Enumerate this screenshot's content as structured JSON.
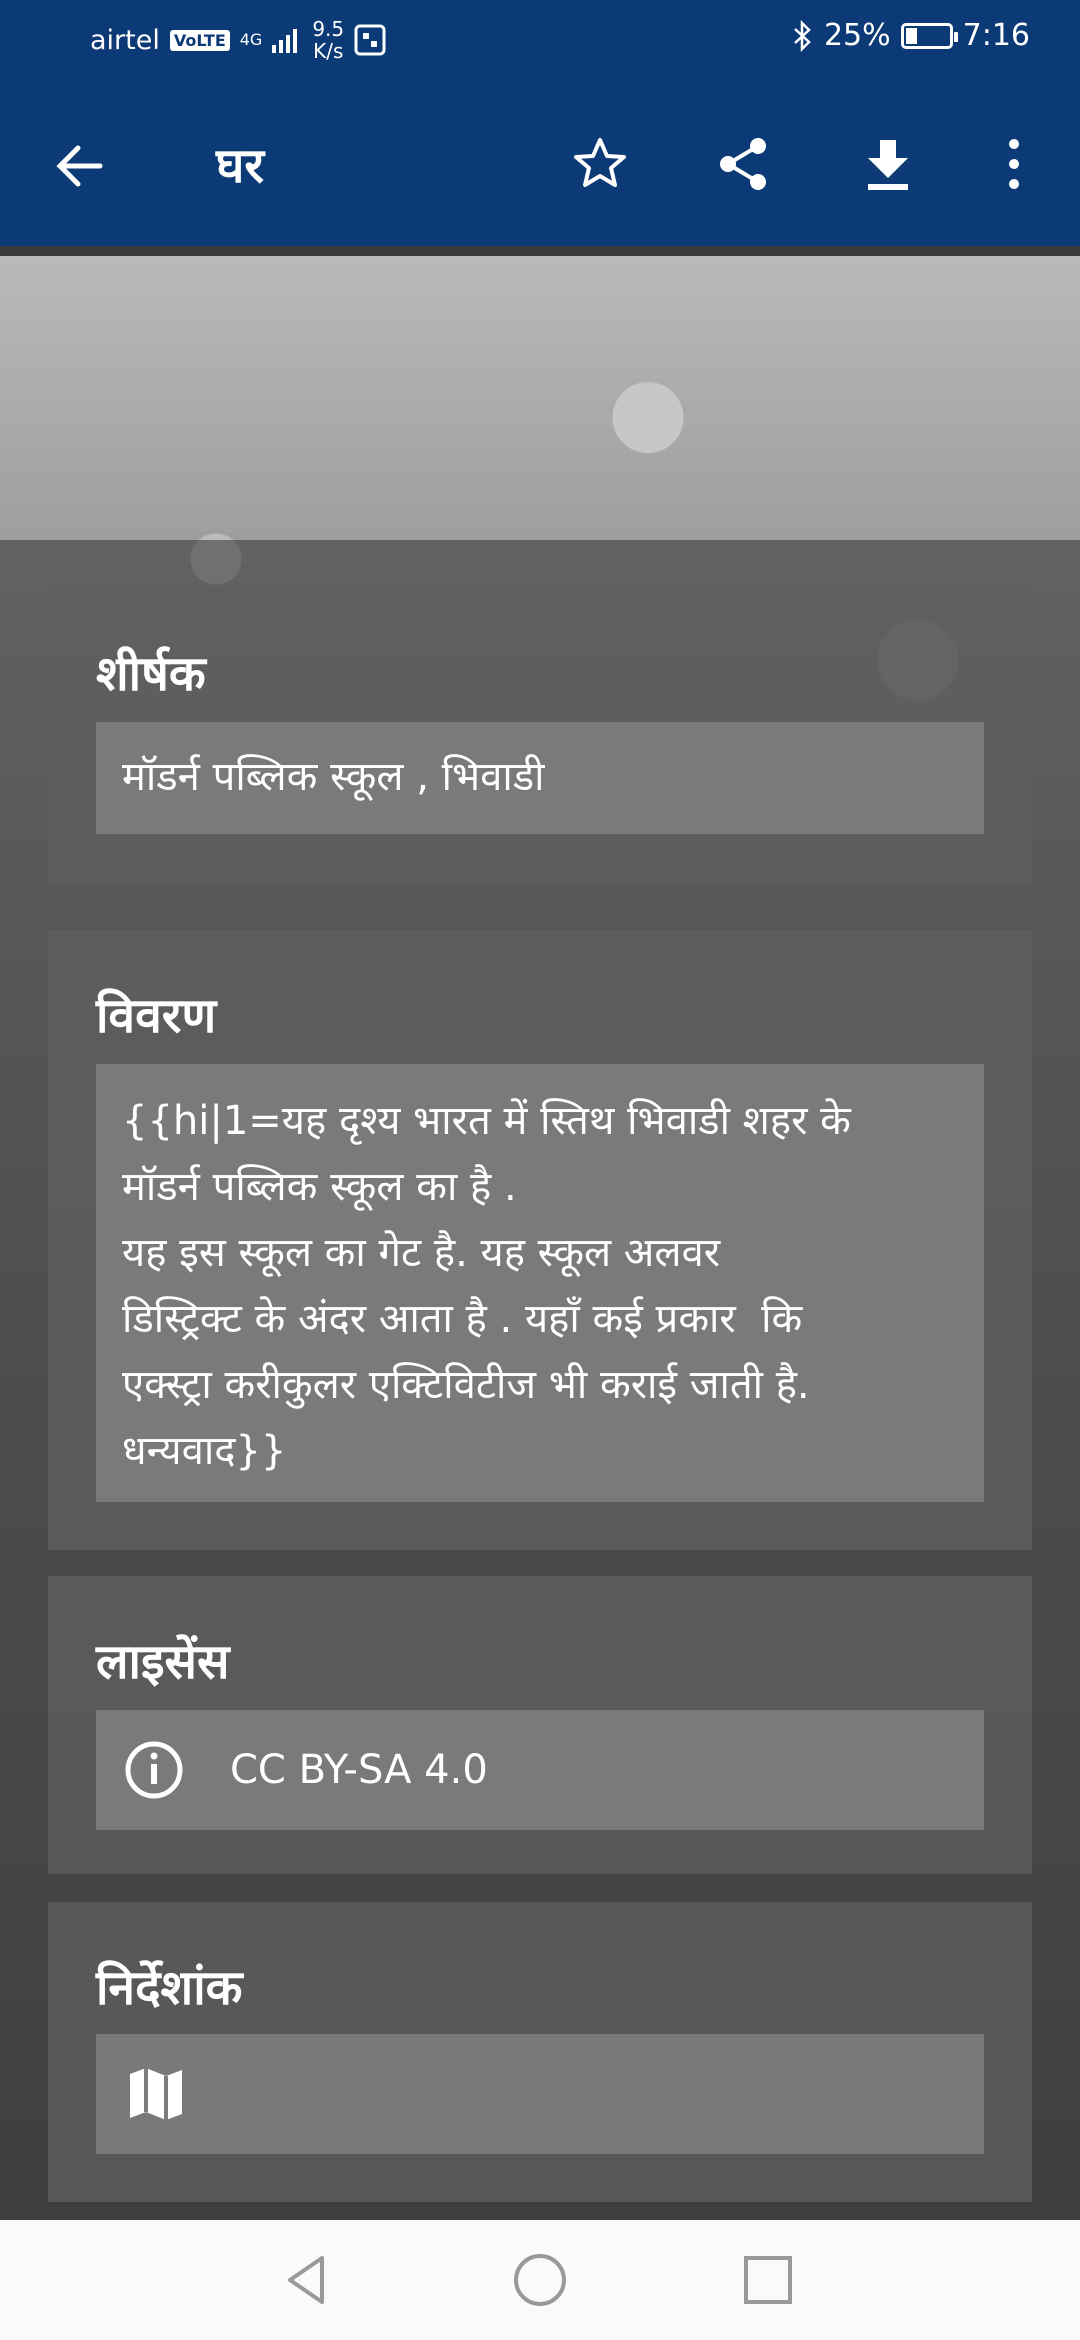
{
  "status_bar": {
    "carrier": "airtel",
    "volte": "VoLTE",
    "network": "4G",
    "speed_value": "9.5",
    "speed_unit": "K/s",
    "battery": "25%",
    "time": "7:16"
  },
  "app_bar": {
    "title": "घर"
  },
  "cards": {
    "title": {
      "heading": "शीर्षक",
      "value": "मॉडर्न पब्लिक स्कूल , भिवाडी"
    },
    "description": {
      "heading": "विवरण",
      "value": "{{hi|1=यह दृश्य भारत में स्तिथ भिवाडी शहर के\nमॉडर्न पब्लिक स्कूल का है .\nयह इस स्कूल का गेट है. यह स्कूल अलवर\nडिस्ट्रिक्ट के अंदर आता है . यहाँ कई प्रकार  कि\nएक्स्ट्रा करीकुलर एक्टिविटीज भी कराई जाती है.\nधन्यवाद}}"
    },
    "license": {
      "heading": "लाइसेंस",
      "value": "CC BY-SA 4.0"
    },
    "coordinates": {
      "heading": "निर्देशांक"
    }
  },
  "colors": {
    "primary": "#0b3a76",
    "card_bg": "#5f5f5f",
    "field_bg": "#7d7d7d"
  },
  "icons": [
    "back-icon",
    "star-icon",
    "share-icon",
    "download-icon",
    "more-icon",
    "info-icon",
    "map-icon",
    "nav-back-icon",
    "nav-home-icon",
    "nav-recent-icon"
  ]
}
